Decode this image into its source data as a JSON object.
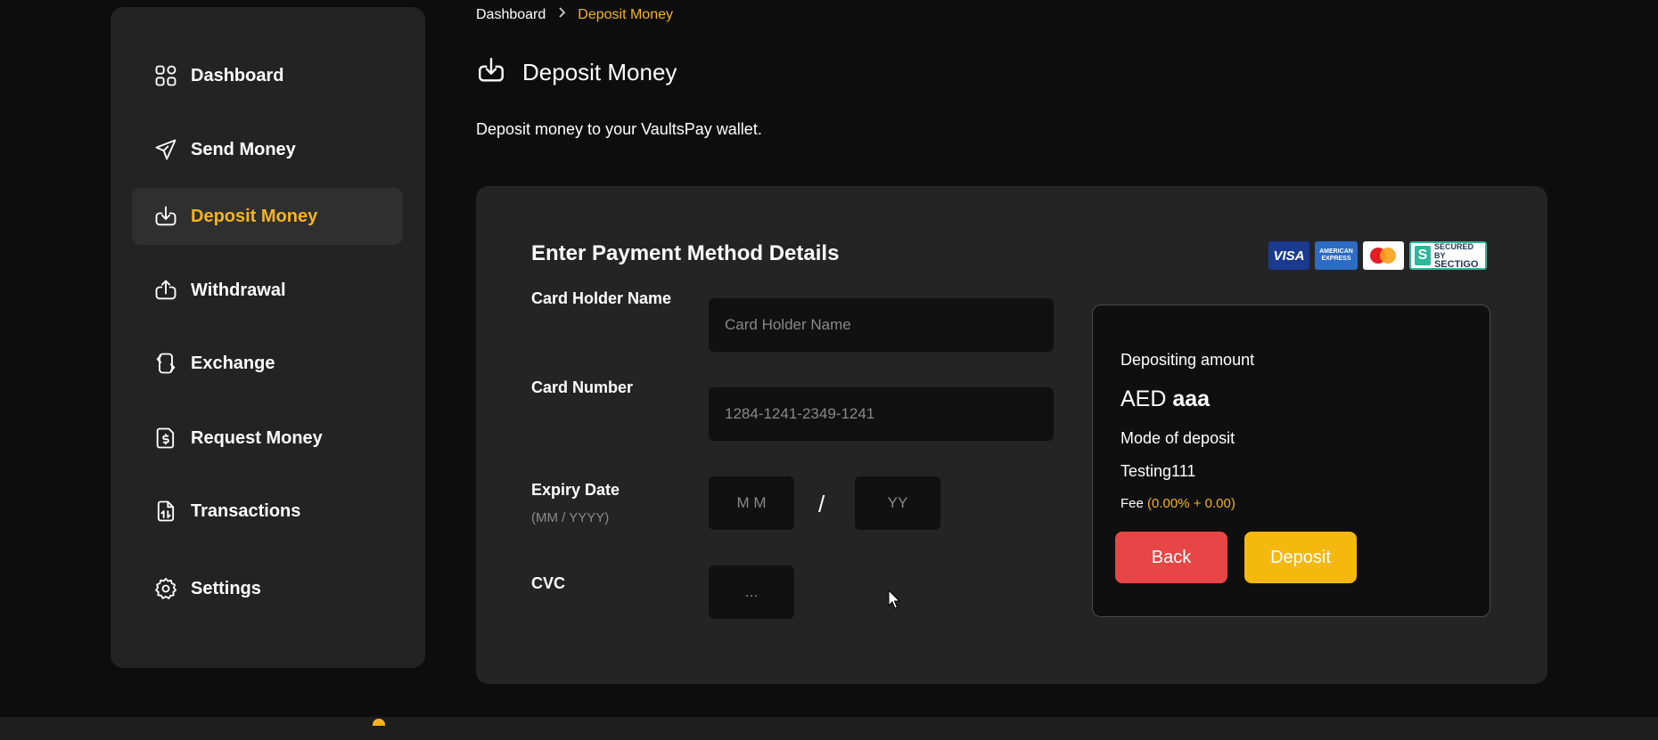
{
  "breadcrumb": {
    "home": "Dashboard",
    "current": "Deposit Money"
  },
  "page": {
    "title": "Deposit Money",
    "subtitle": "Deposit money to your VaultsPay wallet."
  },
  "sidebar": {
    "items": [
      {
        "label": "Dashboard",
        "icon": "grid-icon"
      },
      {
        "label": "Send Money",
        "icon": "send-icon"
      },
      {
        "label": "Deposit Money",
        "icon": "download-icon",
        "active": true
      },
      {
        "label": "Withdrawal",
        "icon": "upload-icon"
      },
      {
        "label": "Exchange",
        "icon": "exchange-icon"
      },
      {
        "label": "Request Money",
        "icon": "request-icon"
      },
      {
        "label": "Transactions",
        "icon": "transactions-icon"
      },
      {
        "label": "Settings",
        "icon": "gear-icon"
      }
    ]
  },
  "form": {
    "heading": "Enter Payment Method Details",
    "card_holder": {
      "label": "Card Holder Name",
      "placeholder": "Card Holder Name",
      "value": ""
    },
    "card_number": {
      "label": "Card Number",
      "placeholder": "1284-1241-2349-1241",
      "value": ""
    },
    "expiry": {
      "label": "Expiry Date",
      "hint": "(MM / YYYY)",
      "month_placeholder": "M M",
      "separator": "/",
      "year_placeholder": "YY"
    },
    "cvc": {
      "label": "CVC",
      "placeholder": "..."
    }
  },
  "logos": {
    "visa": "VISA",
    "amex": "AMERICAN EXPRESS",
    "mastercard": "MasterCard",
    "sectigo_line1": "SECURED BY",
    "sectigo_line2": "SECTIGO"
  },
  "summary": {
    "amount_label": "Depositing amount",
    "currency": "AED",
    "amount": "aaa",
    "mode_label": "Mode of deposit",
    "mode_value": "Testing111",
    "fee_label": "Fee",
    "fee_value": "(0.00% + 0.00)",
    "back_label": "Back",
    "deposit_label": "Deposit"
  },
  "colors": {
    "accent": "#f5b41e",
    "back_button": "#e84646",
    "deposit_button": "#f5b80f",
    "background": "#0d0d0d",
    "panel": "#242424"
  }
}
